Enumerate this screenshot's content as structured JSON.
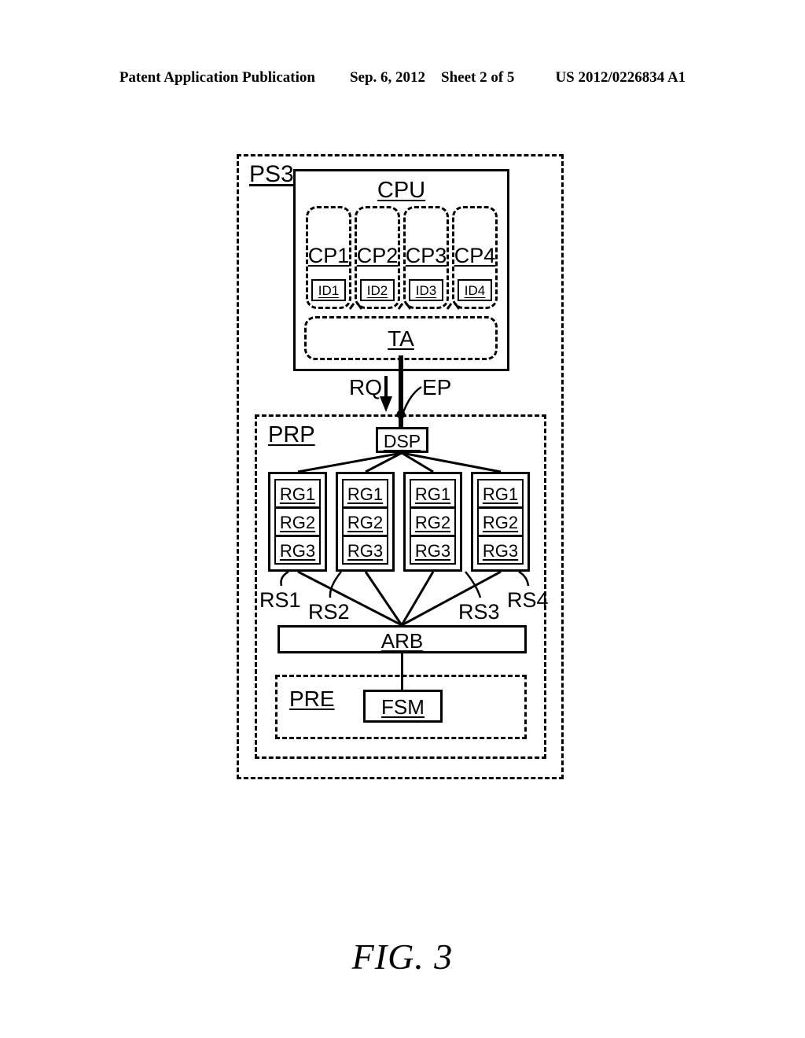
{
  "header": {
    "publication": "Patent Application Publication",
    "date": "Sep. 6, 2012",
    "sheet": "Sheet 2 of 5",
    "patent_number": "US 2012/0226834 A1"
  },
  "figure": {
    "caption": "FIG. 3"
  },
  "diagram": {
    "outer_container_label": "PS3",
    "cpu": {
      "label": "CPU",
      "cores": [
        {
          "label": "CP1",
          "id_label": "ID1"
        },
        {
          "label": "CP2",
          "id_label": "ID2"
        },
        {
          "label": "CP3",
          "id_label": "ID3"
        },
        {
          "label": "CP4",
          "id_label": "ID4"
        }
      ],
      "ta_label": "TA"
    },
    "connector": {
      "request_label": "RQ",
      "endpoint_label": "EP"
    },
    "prp": {
      "label": "PRP",
      "dispatcher_label": "DSP",
      "register_sets": [
        {
          "set_label": "RS1",
          "registers": [
            "RG1",
            "RG2",
            "RG3"
          ]
        },
        {
          "set_label": "RS2",
          "registers": [
            "RG1",
            "RG2",
            "RG3"
          ]
        },
        {
          "set_label": "RS3",
          "registers": [
            "RG1",
            "RG2",
            "RG3"
          ]
        },
        {
          "set_label": "RS4",
          "registers": [
            "RG1",
            "RG2",
            "RG3"
          ]
        }
      ],
      "arbiter_label": "ARB",
      "pre": {
        "label": "PRE",
        "fsm_label": "FSM"
      }
    }
  },
  "colors": {
    "ink": "#000000",
    "paper": "#ffffff"
  }
}
